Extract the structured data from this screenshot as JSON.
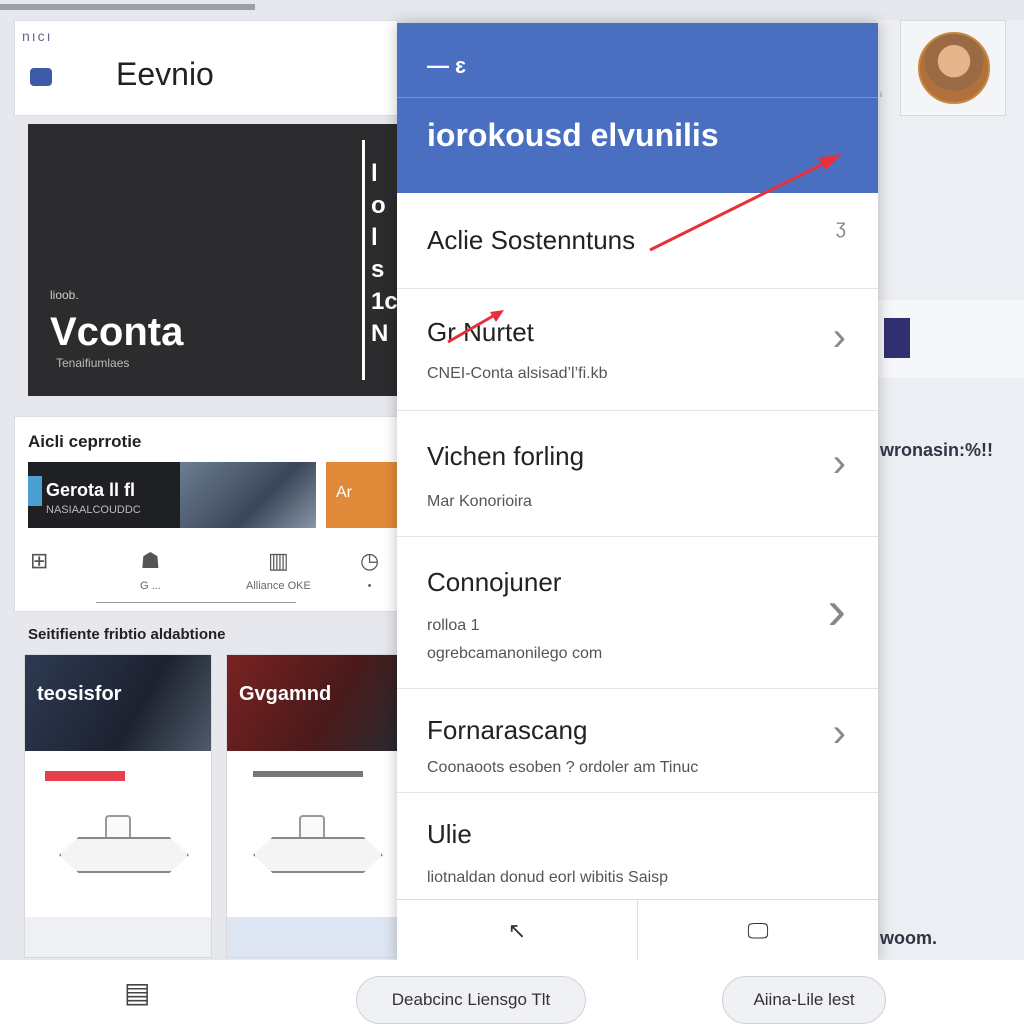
{
  "app": {
    "title": "Eevnio",
    "tiny_label": "nıcı"
  },
  "hero": {
    "small": "lioob.",
    "big": "Vconta",
    "sub": "Tenaifiumlaes",
    "vertical": [
      "l",
      "o",
      "l",
      "s",
      "l",
      "1c",
      "N"
    ]
  },
  "section1": {
    "title": "Aicli ceprrotie",
    "thumbs": {
      "t1_title": "Gerota ll fl",
      "t1_sub": "NASIAALCOUDDC",
      "t3_label": "Ar"
    },
    "icons": [
      {
        "icon": "grid-icon",
        "glyph": "⊞",
        "label": ""
      },
      {
        "icon": "book-icon",
        "glyph": "☗",
        "label": "G ..."
      },
      {
        "icon": "chart-icon",
        "glyph": "▥",
        "label": "Alliance OKE"
      },
      {
        "icon": "clock-icon",
        "glyph": "◷",
        "label": "•"
      }
    ]
  },
  "section2": {
    "title": "Seitifiente fribtio aldabtione",
    "cards": [
      {
        "img_label": "teosisfor",
        "foot": ""
      },
      {
        "img_label": "Gvgamnd",
        "foot": ""
      }
    ]
  },
  "modal": {
    "header_icons": "—  ɛ",
    "header_title": "iorokousd elvunilis",
    "rows": [
      {
        "title": "Aclie Sostenntuns",
        "sub": "",
        "chev": "›"
      },
      {
        "title": "Gr Nurtet",
        "sub": "CNEI-Conta alsisad’l’fi.kb",
        "chev": "›"
      },
      {
        "title": "Vichen forling",
        "sub": "Mar Konorioira",
        "chev": "›"
      },
      {
        "title": "Connojuner",
        "sub": "rolloa 1",
        "sub2": "ogrebcamanonilego com",
        "chev": "›"
      },
      {
        "title": "Fornarascang",
        "sub": "Coonaoots esoben ? ordoler am Tinuc",
        "chev": "›"
      },
      {
        "title": "Ulie",
        "sub": "liotnaldan donud eorl wibitis Saisp",
        "chev": ""
      }
    ],
    "footer": {
      "left_icon": "arrow-icon",
      "left_glyph": "↖",
      "right_icon": "screen-icon",
      "right_glyph": "🖵"
    }
  },
  "background_right": {
    "text1": "wronasin:%!!",
    "text2": "woom."
  },
  "bottom_bar": {
    "icon": "window-icon",
    "pill1": "Deabcinc Liensgo Tlt",
    "pill2": "Aiina-Lile lest"
  },
  "colors": {
    "header": "#4a6fc0",
    "arrow": "#e8303a",
    "accent_red": "#e8404a"
  }
}
